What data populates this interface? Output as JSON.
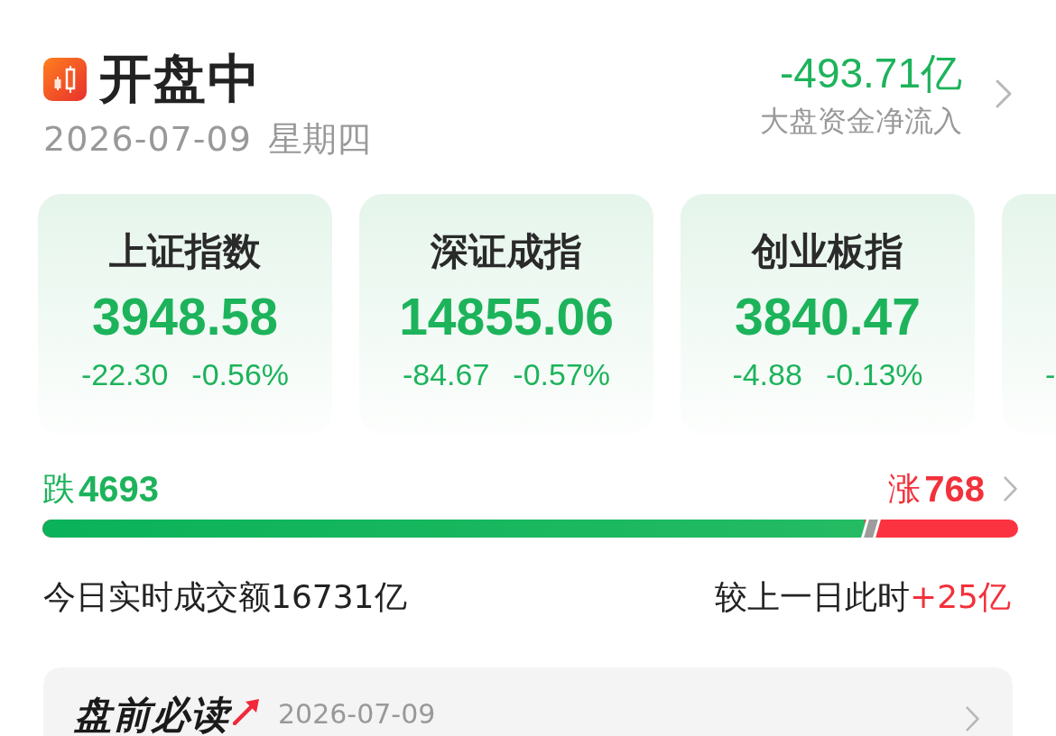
{
  "header": {
    "status": "开盘中",
    "date": "2026-07-09",
    "weekday": "星期四",
    "net_flow": {
      "value": "-493.71亿",
      "label": "大盘资金净流入"
    }
  },
  "indices": [
    {
      "name": "上证指数",
      "value": "3948.58",
      "change": "-22.30",
      "change_pct": "-0.56%"
    },
    {
      "name": "深证成指",
      "value": "14855.06",
      "change": "-84.67",
      "change_pct": "-0.57%"
    },
    {
      "name": "创业板指",
      "value": "3840.47",
      "change": "-4.88",
      "change_pct": "-0.13%"
    },
    {
      "change": "-"
    }
  ],
  "breadth": {
    "down": {
      "label": "跌",
      "count": "4693"
    },
    "up": {
      "label": "涨",
      "count": "768"
    },
    "bar": {
      "level": 0.843
    }
  },
  "turnover": {
    "label": "今日实时成交额",
    "value": "16731亿",
    "compare_label": "较上一日此时",
    "compare_value": "+25亿"
  },
  "briefing": {
    "title": "盘前必读",
    "date": "2026-07-09"
  }
}
